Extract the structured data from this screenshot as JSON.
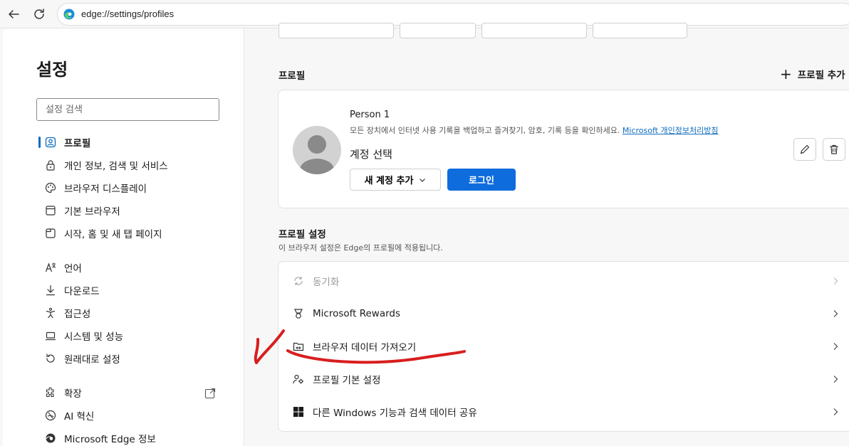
{
  "browser": {
    "url": "edge://settings/profiles"
  },
  "sidebar": {
    "title": "설정",
    "search_placeholder": "설정 검색",
    "items": [
      {
        "label": "프로필",
        "icon": "profile-icon"
      },
      {
        "label": "개인 정보, 검색 및 서비스",
        "icon": "lock-icon"
      },
      {
        "label": "브라우저 디스플레이",
        "icon": "palette-icon"
      },
      {
        "label": "기본 브라우저",
        "icon": "browser-icon"
      },
      {
        "label": "시작, 홈 및 새 탭 페이지",
        "icon": "home-tab-icon"
      },
      {
        "label": "언어",
        "icon": "language-icon"
      },
      {
        "label": "다운로드",
        "icon": "download-icon"
      },
      {
        "label": "접근성",
        "icon": "accessibility-icon"
      },
      {
        "label": "시스템 및 성능",
        "icon": "laptop-icon"
      },
      {
        "label": "원래대로 설정",
        "icon": "reset-icon"
      },
      {
        "label": "확장",
        "icon": "puzzle-icon"
      },
      {
        "label": "AI 혁신",
        "icon": "ai-icon"
      },
      {
        "label": "Microsoft Edge 정보",
        "icon": "edge-icon"
      }
    ]
  },
  "profile": {
    "section_title": "프로필",
    "add_profile_label": "프로필 추가",
    "person_name": "Person 1",
    "description": "모든 장치에서 인터넷 사용 기록을 백업하고 즐겨찾기, 암호, 기록 등을 확인하세요.",
    "privacy_link": "Microsoft 개인정보처리방침",
    "account_select_label": "계정 선택",
    "add_account_button": "새 계정 추가",
    "login_button": "로그인"
  },
  "profile_settings": {
    "title": "프로필 설정",
    "subtitle": "이 브라우저 설정은 Edge의 프로필에 적용됩니다.",
    "rows": [
      {
        "label": "동기화",
        "icon": "sync-icon",
        "disabled": true
      },
      {
        "label": "Microsoft Rewards",
        "icon": "rewards-icon",
        "disabled": false
      },
      {
        "label": "브라우저 데이터 가져오기",
        "icon": "import-icon",
        "disabled": false
      },
      {
        "label": "프로필 기본 설정",
        "icon": "profile-settings-icon",
        "disabled": false
      },
      {
        "label": "다른 Windows 기능과 검색 데이터 공유",
        "icon": "windows-icon",
        "disabled": false
      }
    ]
  },
  "colors": {
    "accent": "#0f6cdd",
    "annotation": "#d81e1e"
  }
}
